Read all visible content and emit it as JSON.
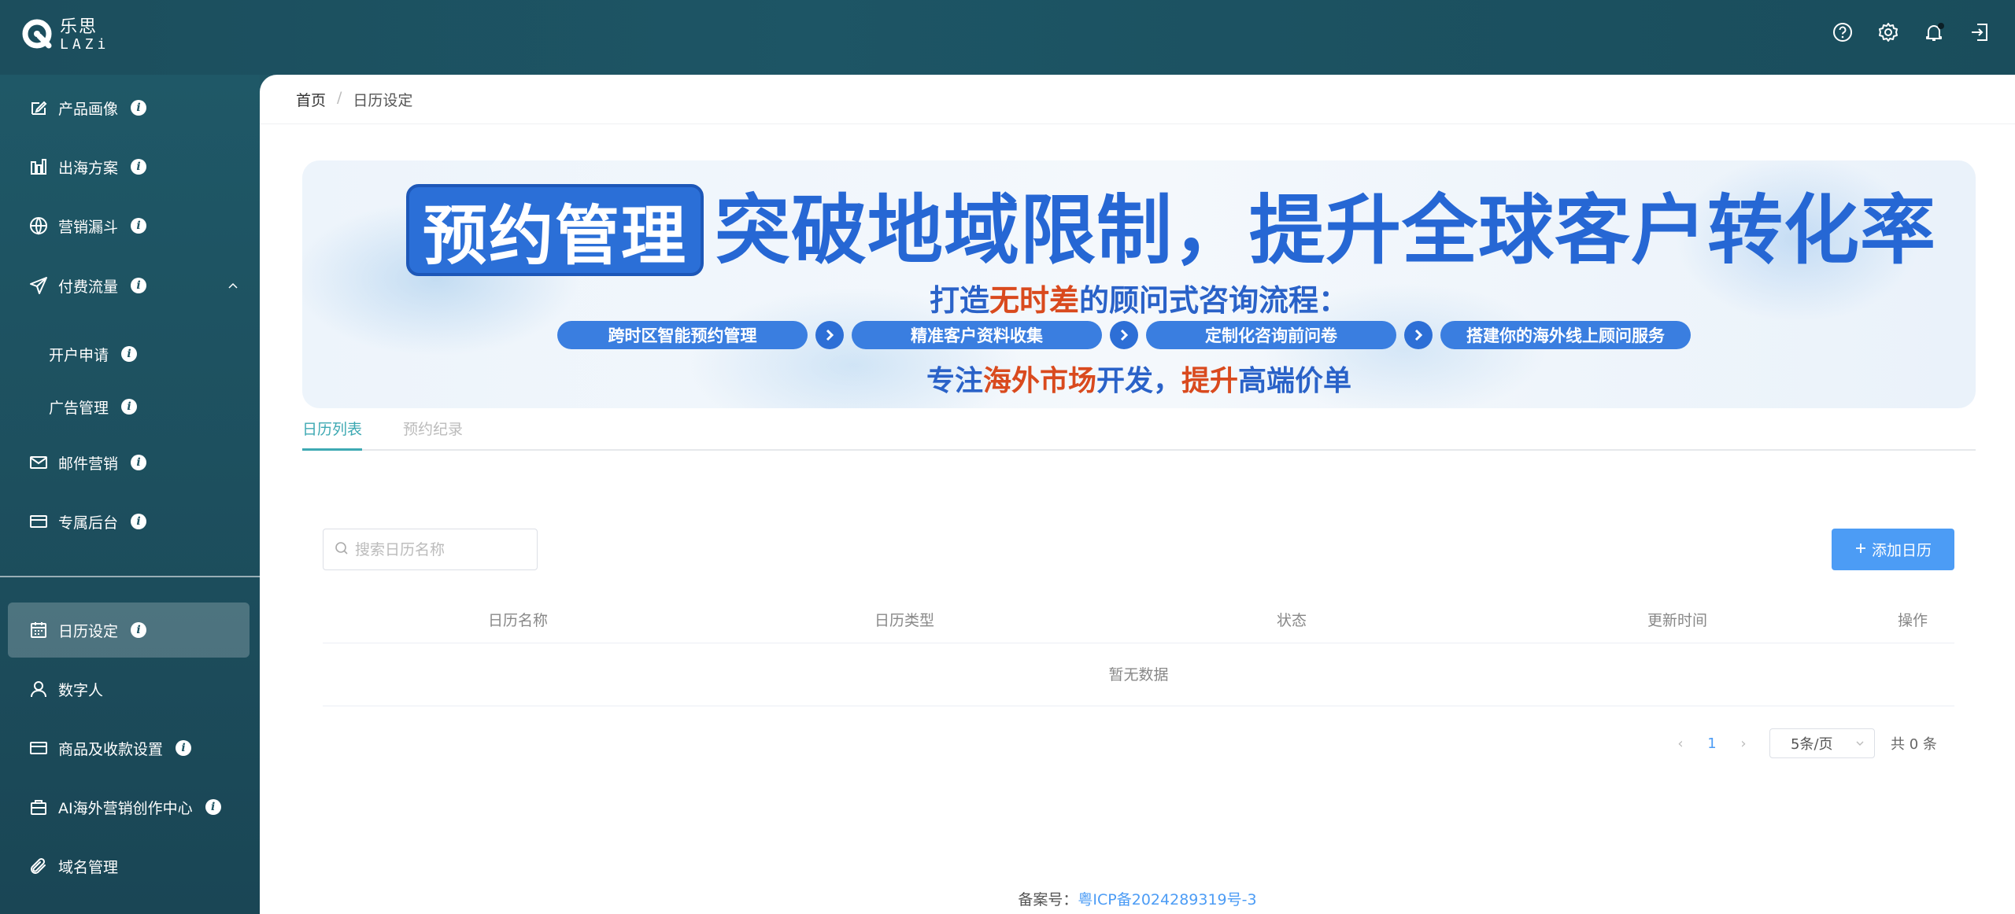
{
  "brand": {
    "name_cn": "乐思",
    "name_en": "LAZi"
  },
  "header": {
    "icons": [
      "help-icon",
      "settings-icon",
      "bell-icon",
      "logout-icon"
    ]
  },
  "sidebar": {
    "items": [
      {
        "label": "产品画像",
        "icon": "edit-icon"
      },
      {
        "label": "出海方案",
        "icon": "bar-chart-icon"
      },
      {
        "label": "营销漏斗",
        "icon": "globe-icon"
      },
      {
        "label": "付费流量",
        "icon": "send-icon"
      },
      {
        "label": "开户申请"
      },
      {
        "label": "广告管理"
      },
      {
        "label": "邮件营销",
        "icon": "mail-icon"
      },
      {
        "label": "专属后台",
        "icon": "card-icon"
      },
      {
        "label": "日历设定",
        "icon": "calendar-icon"
      },
      {
        "label": "数字人",
        "icon": "user-icon"
      },
      {
        "label": "商品及收款设置",
        "icon": "card-icon"
      },
      {
        "label": "AI海外营销创作中心",
        "icon": "briefcase-icon"
      },
      {
        "label": "域名管理",
        "icon": "paperclip-icon"
      }
    ]
  },
  "breadcrumb": {
    "home": "首页",
    "sep": "/",
    "current": "日历设定"
  },
  "banner": {
    "badge": "预约管理",
    "headline": "突破地域限制，提升全球客户转化率",
    "sub_pre": "打造",
    "sub_hl": "无时差",
    "sub_post": "的顾问式咨询流程：",
    "steps": [
      "跨时区智能预约管理",
      "精准客户资料收集",
      "定制化咨询前问卷",
      "搭建你的海外线上顾问服务"
    ],
    "tag_1": "专注",
    "tag_2": "海外市场",
    "tag_3": "开发，",
    "tag_4": "提升",
    "tag_5": "高端价单"
  },
  "tabs": [
    "日历列表",
    "预约纪录"
  ],
  "search": {
    "placeholder": "搜索日历名称"
  },
  "add_button": {
    "label": "添加日历"
  },
  "table": {
    "columns": [
      "日历名称",
      "日历类型",
      "状态",
      "更新时间",
      "操作"
    ],
    "empty_text": "暂无数据"
  },
  "pagination": {
    "current_page": "1",
    "page_size": "5条/页",
    "total": "共 0 条"
  },
  "footer": {
    "label": "备案号：",
    "icp": "粤ICP备2024289319号-3"
  },
  "colors": {
    "primary": "#4c9cf5",
    "sidebar_bg": "#1f5564",
    "tab_active": "#3ea9b3",
    "banner_blue": "#2667d4",
    "banner_orange": "#d94a1e"
  }
}
